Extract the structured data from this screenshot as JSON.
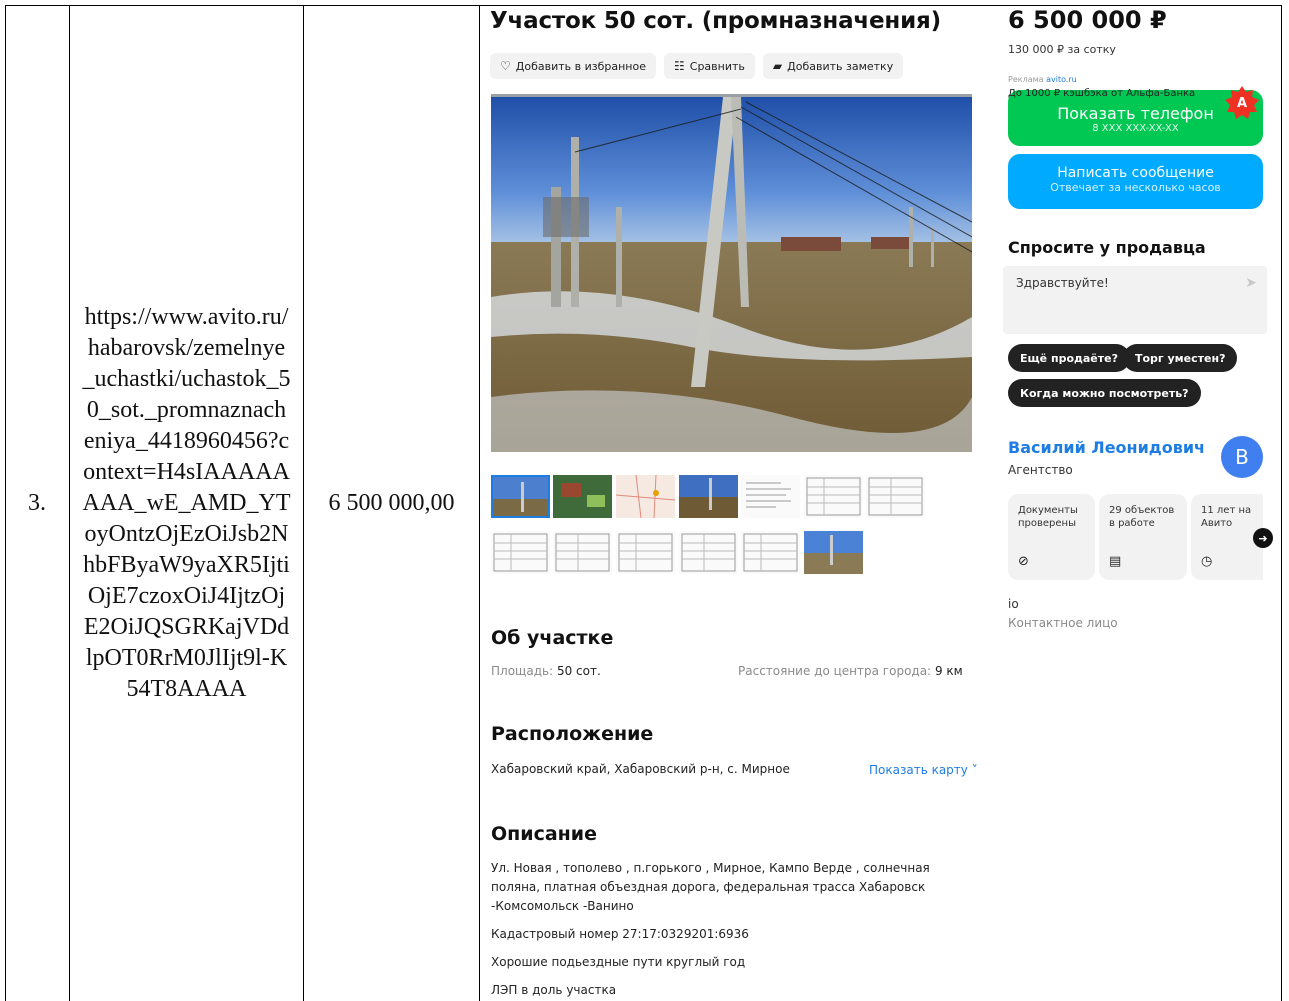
{
  "row": {
    "number": "3.",
    "url": "https://www.avito.ru/habarovsk/zemelnye_uchastki/uchastok_50_sot._promnaznacheniya_4418960456?context=H4sIAAAAAAAA_wE_AMD_YToyOntzOjEzOiJsb2NhbFByaW9yaXR5IjtiOjE7czoxOiJ4IjtzOjE2OiJQSGRKajVDdlpOT0RrM0JlIjt9l-K54T8AAAA",
    "price": "6 500 000,00"
  },
  "listing": {
    "title": "Участок 50 сот. (промназначения)",
    "actions": [
      {
        "label": "Добавить в избранное",
        "icon": "heart-icon",
        "glyph": "♡"
      },
      {
        "label": "Сравнить",
        "icon": "compare-icon",
        "glyph": "☷"
      },
      {
        "label": "Добавить заметку",
        "icon": "note-icon",
        "glyph": "▰"
      }
    ],
    "about_title": "Об участке",
    "area_label": "Площадь:",
    "area_value": "50 сот.",
    "distance_label": "Расстояние до центра города:",
    "distance_value": "9 км",
    "location_title": "Расположение",
    "address": "Хабаровский край, Хабаровский р-н, с. Мирное",
    "show_map": "Показать карту ˅",
    "description_title": "Описание",
    "description": [
      "Ул. Новая , тополево , п.горького , Мирное, Кампо Верде , солнечная поляна, платная объездная дорога, федеральная трасса Хабаровск -Комсомольск -Ванино",
      "Кадастровый номер 27:17:0329201:6936",
      "Хорошие подьездные пути круглый год",
      "ЛЭП в доль участка"
    ]
  },
  "sidebar": {
    "price": "6 500 000 ₽",
    "price_per": "130 000 ₽ за сотку",
    "ad_label": "Реклама",
    "ad_link": "avito.ru",
    "cashback": "До 1000 ₽ кэшбэка от Альфа-Банка",
    "phone_button": "Показать телефон",
    "phone_masked": "8 XXX XXX-XX-XX",
    "message_button": "Написать сообщение",
    "message_sub": "Отвечает за несколько часов",
    "ask_title": "Спросите у продавца",
    "ask_text": "Здравствуйте!",
    "chips": [
      "Ещё продаёте?",
      "Торг уместен?",
      "Когда можно посмотреть?"
    ],
    "seller_name": "Василий Леонидович",
    "seller_type": "Агентство",
    "avatar_letter": "В",
    "stats": [
      {
        "text": "Документы проверены",
        "icon": "check-circle-icon",
        "glyph": "⊘"
      },
      {
        "text": "29 объектов в работе",
        "icon": "building-icon",
        "glyph": "▤"
      },
      {
        "text": "11 лет на Авито",
        "icon": "clock-icon",
        "glyph": "◷"
      }
    ],
    "contact_name": "io",
    "contact_role": "Контактное лицо"
  },
  "colors": {
    "green": "#00c853",
    "blue": "#00aaff",
    "link": "#1e7de3"
  }
}
